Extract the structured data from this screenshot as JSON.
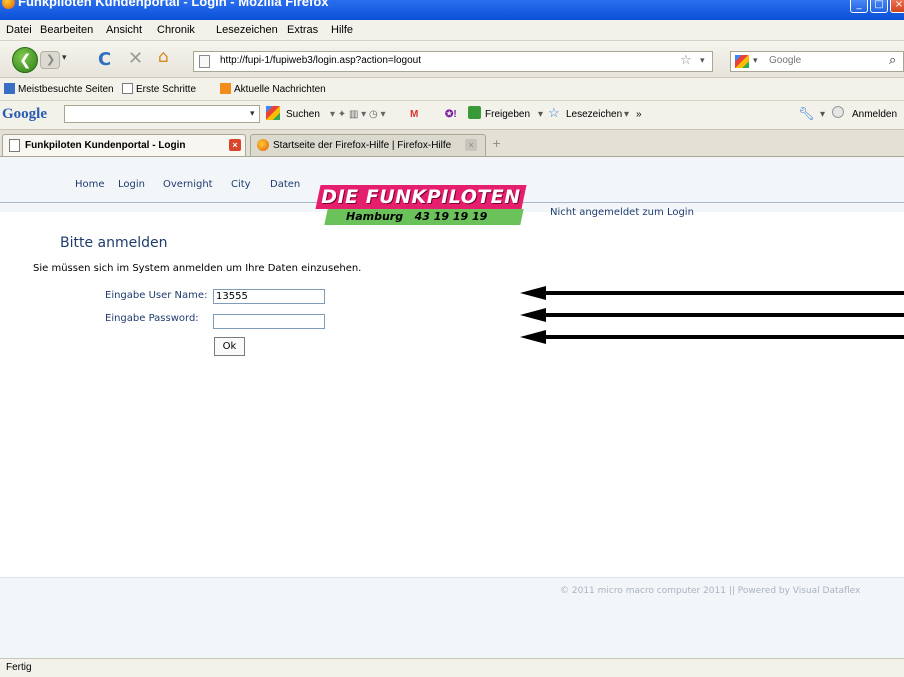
{
  "window": {
    "title": "Funkpiloten Kundenportal - Login - Mozilla Firefox"
  },
  "menubar": {
    "items": [
      "Datei",
      "Bearbeiten",
      "Ansicht",
      "Chronik",
      "Lesezeichen",
      "Extras",
      "Hilfe"
    ]
  },
  "navbar": {
    "url": "http://fupi-1/fupiweb3/login.asp?action=logout",
    "search_placeholder": "Google"
  },
  "bookmarks": {
    "items": [
      "Meistbesuchte Seiten",
      "Erste Schritte",
      "Aktuelle Nachrichten"
    ]
  },
  "google_toolbar": {
    "logo": "Google",
    "search_label": "Suchen",
    "share_label": "Freigeben",
    "bookmarks_label": "Lesezeichen",
    "more_label": "»",
    "signin_label": "Anmelden"
  },
  "tabs": [
    {
      "label": "Funkpiloten Kundenportal - Login",
      "active": true
    },
    {
      "label": "Startseite der Firefox-Hilfe | Firefox-Hilfe",
      "active": false
    }
  ],
  "page": {
    "nav": [
      "Home",
      "Login",
      "Overnight",
      "City",
      "Daten"
    ],
    "logo": {
      "line1": "DIE FUNKPILOTEN",
      "line2": "Hamburg   43 19 19 19"
    },
    "login_status": "Nicht angemeldet zum Login",
    "title": "Bitte anmelden",
    "intro": "Sie müssen sich im System anmelden um Ihre Daten einzusehen.",
    "form": {
      "username_label": "Eingabe User Name:",
      "username_value": "13555",
      "password_label": "Eingabe Password:",
      "password_value": "",
      "ok_label": "Ok"
    },
    "footer": "© 2011 micro macro computer 2011 || Powered by Visual Dataflex"
  },
  "status": {
    "text": "Fertig"
  },
  "colors": {
    "brand_pink": "#e61e6e",
    "brand_green": "#6cc25a",
    "link_blue": "#1f3c6e",
    "titlebar_blue": "#0b4fd6"
  }
}
